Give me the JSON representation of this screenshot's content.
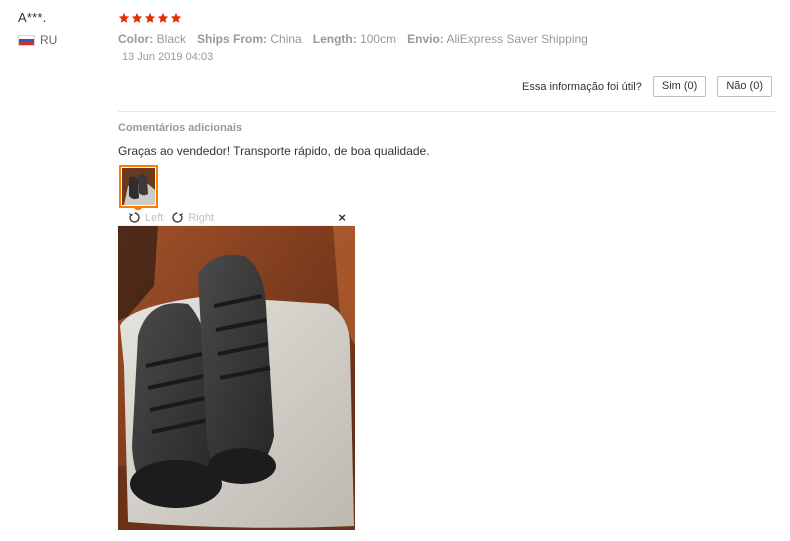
{
  "reviewer": {
    "name": "A***.",
    "country": "RU"
  },
  "rating": {
    "stars": 5,
    "max": 5,
    "color": "#e62e04"
  },
  "properties": [
    {
      "label": "Color:",
      "value": "Black"
    },
    {
      "label": "Ships From:",
      "value": "China"
    },
    {
      "label": "Length:",
      "value": "100cm"
    },
    {
      "label": "Envio:",
      "value": "AliExpress Saver Shipping"
    }
  ],
  "date": "13 Jun 2019 04:03",
  "feedback": {
    "question": "Essa informação foi útil?",
    "yes_label": "Sim (0)",
    "no_label": "Não (0)"
  },
  "additional": {
    "title": "Comentários adicionais",
    "text": "Graças ao vendedor! Transporte rápido, de boa qualidade."
  },
  "viewer": {
    "rotate_left_label": "Left",
    "rotate_right_label": "Right",
    "close_label": "×"
  },
  "colors": {
    "accent_orange": "#ff7a00",
    "star_red": "#e62e04"
  }
}
